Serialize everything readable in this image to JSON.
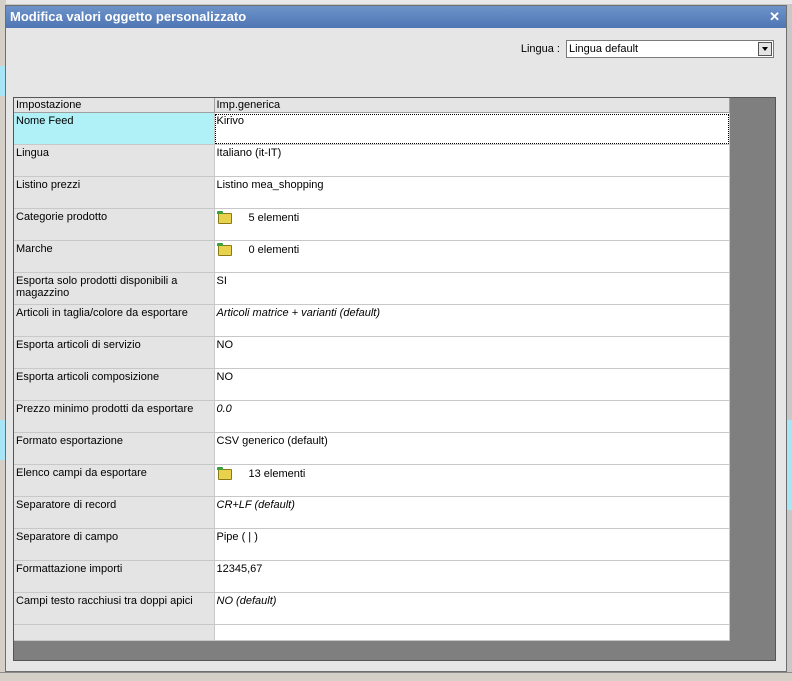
{
  "window": {
    "title": "Modifica valori oggetto personalizzato"
  },
  "language": {
    "label": "Lingua :",
    "selected": "Lingua default"
  },
  "grid": {
    "headers": [
      "Impostazione",
      "Imp.generica"
    ],
    "rows": [
      {
        "key": "Nome Feed",
        "value": "Kirivo"
      },
      {
        "key": "Lingua",
        "value": "Italiano (it-IT)"
      },
      {
        "key": "Listino prezzi",
        "value": "Listino mea_shopping"
      },
      {
        "key": "Categorie prodotto",
        "value": "5 elementi",
        "icon": "folder-icon"
      },
      {
        "key": "Marche",
        "value": "0 elementi",
        "icon": "folder-icon"
      },
      {
        "key": "Esporta solo prodotti disponibili a magazzino",
        "value": "SI"
      },
      {
        "key": "Articoli in taglia/colore da esportare",
        "value": "Articoli matrice + varianti (default)",
        "italic": true
      },
      {
        "key": "Esporta articoli di servizio",
        "value": "NO"
      },
      {
        "key": "Esporta articoli composizione",
        "value": "NO"
      },
      {
        "key": "Prezzo minimo prodotti da esportare",
        "value": "0.0",
        "italic": true
      },
      {
        "key": "Formato esportazione",
        "value": "CSV generico (default)"
      },
      {
        "key": "Elenco campi da esportare",
        "value": "13 elementi",
        "icon": "folder-icon"
      },
      {
        "key": "Separatore di record",
        "value": "CR+LF (default)",
        "italic": true
      },
      {
        "key": "Separatore di campo",
        "value": "Pipe ( | )"
      },
      {
        "key": "Formattazione importi",
        "value": "12345,67"
      },
      {
        "key": "Campi testo racchiusi tra doppi apici",
        "value": "NO (default)",
        "italic": true
      }
    ]
  },
  "colors": {
    "titlebar": "#5a80bd",
    "selected_key": "#b0f0f7",
    "key_cell": "#e4e4e4"
  }
}
